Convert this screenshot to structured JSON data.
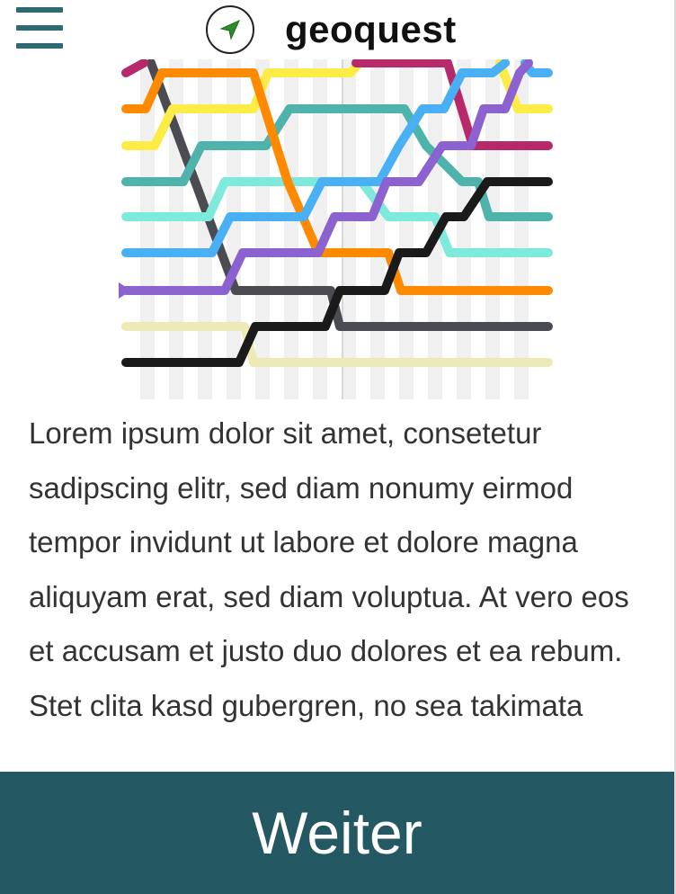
{
  "header": {
    "app_title": "geoquest",
    "menu_icon": "hamburger-menu-icon",
    "logo_icon": "navigation-arrow-icon"
  },
  "illustration": {
    "icon": "route-lines-illustration",
    "colors": {
      "magenta": "#b8296b",
      "orange": "#ff8a00",
      "yellow": "#fdec45",
      "teal": "#4db3ab",
      "cyan": "#7eeadc",
      "blue": "#4ab0f5",
      "purple": "#8b62d0",
      "dark_gray": "#4b4b52",
      "pale_yellow": "#eeeab8",
      "black": "#1a1a1a"
    }
  },
  "content": {
    "body_text": "Lorem ipsum dolor sit amet, consetetur sadipscing elitr, sed diam nonumy eirmod tempor invidunt ut labore et dolore magna aliquyam erat, sed diam voluptua. At vero eos et accusam et justo duo dolores et ea rebum. Stet clita kasd gubergren, no sea takimata"
  },
  "footer": {
    "next_label": "Weiter",
    "button_color": "#245863"
  }
}
